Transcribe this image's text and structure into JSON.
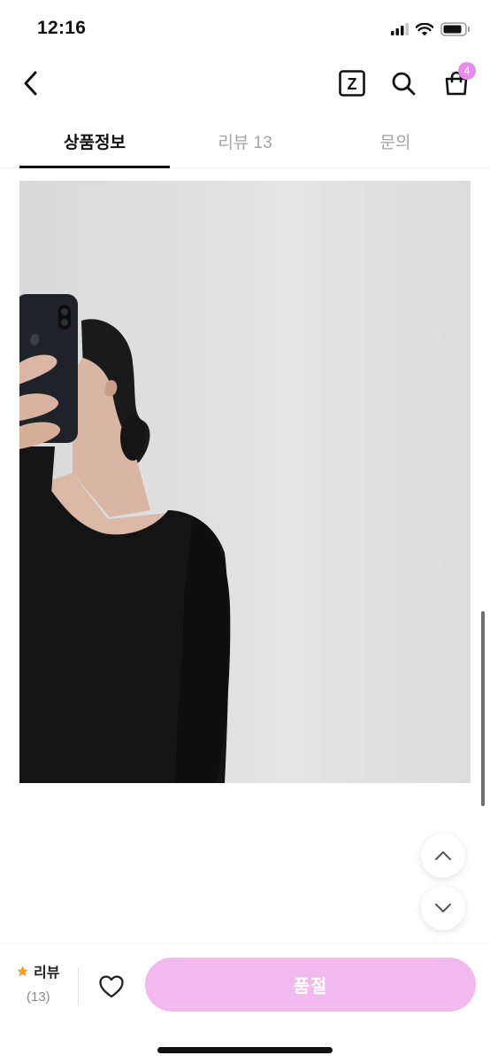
{
  "status_bar": {
    "time": "12:16",
    "icons": [
      "signal-icon",
      "wifi-icon",
      "battery-icon"
    ]
  },
  "header": {
    "back_icon": "chevron-left-icon",
    "z_icon": "z-box-icon",
    "z_letter": "Z",
    "search_icon": "search-icon",
    "cart_icon": "shopping-bag-icon",
    "cart_badge": "4"
  },
  "tabs": [
    {
      "label": "상품정보",
      "active": true
    },
    {
      "label": "리뷰 13",
      "active": false
    },
    {
      "label": "문의",
      "active": false
    }
  ],
  "scroll_buttons": {
    "up_icon": "chevron-up-icon",
    "down_icon": "chevron-down-icon"
  },
  "bottom_bar": {
    "review_label": "리뷰",
    "review_count": "(13)",
    "star_icon": "star-icon",
    "heart_icon": "heart-icon",
    "soldout_label": "품절"
  },
  "colors": {
    "accent_pink": "#f2b9ee",
    "badge_pink": "#e58de6",
    "star_orange": "#f0a030"
  }
}
